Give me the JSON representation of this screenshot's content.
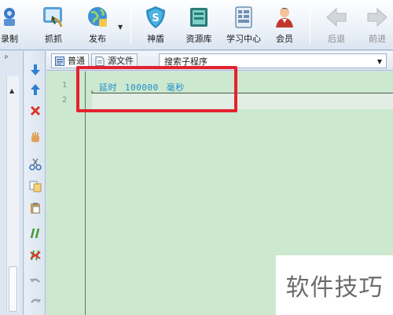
{
  "toolbar": {
    "items": [
      {
        "label": "录制",
        "icon": "record-icon"
      },
      {
        "label": "抓抓",
        "icon": "grab-icon"
      },
      {
        "label": "发布",
        "icon": "publish-icon"
      },
      {
        "label": "神盾",
        "icon": "shield-icon"
      },
      {
        "label": "资源库",
        "icon": "resource-library-icon"
      },
      {
        "label": "学习中心",
        "icon": "learning-center-icon"
      },
      {
        "label": "会员",
        "icon": "member-icon"
      },
      {
        "label": "后退",
        "icon": "back-arrow-icon"
      },
      {
        "label": "前进",
        "icon": "forward-arrow-icon"
      }
    ]
  },
  "editor_header": {
    "tab_normal": "普通",
    "tab_source": "源文件",
    "subroutine_search": "搜索子程序"
  },
  "editor": {
    "line_numbers": [
      "1",
      "2"
    ],
    "code_line_1": {
      "command": "延时",
      "value": "100000",
      "unit": "毫秒"
    }
  },
  "watermark": "软件技巧",
  "colors": {
    "editor_bg": "#cce8cf",
    "code_text": "#1e8ec8",
    "highlight_border": "#e3222f"
  }
}
